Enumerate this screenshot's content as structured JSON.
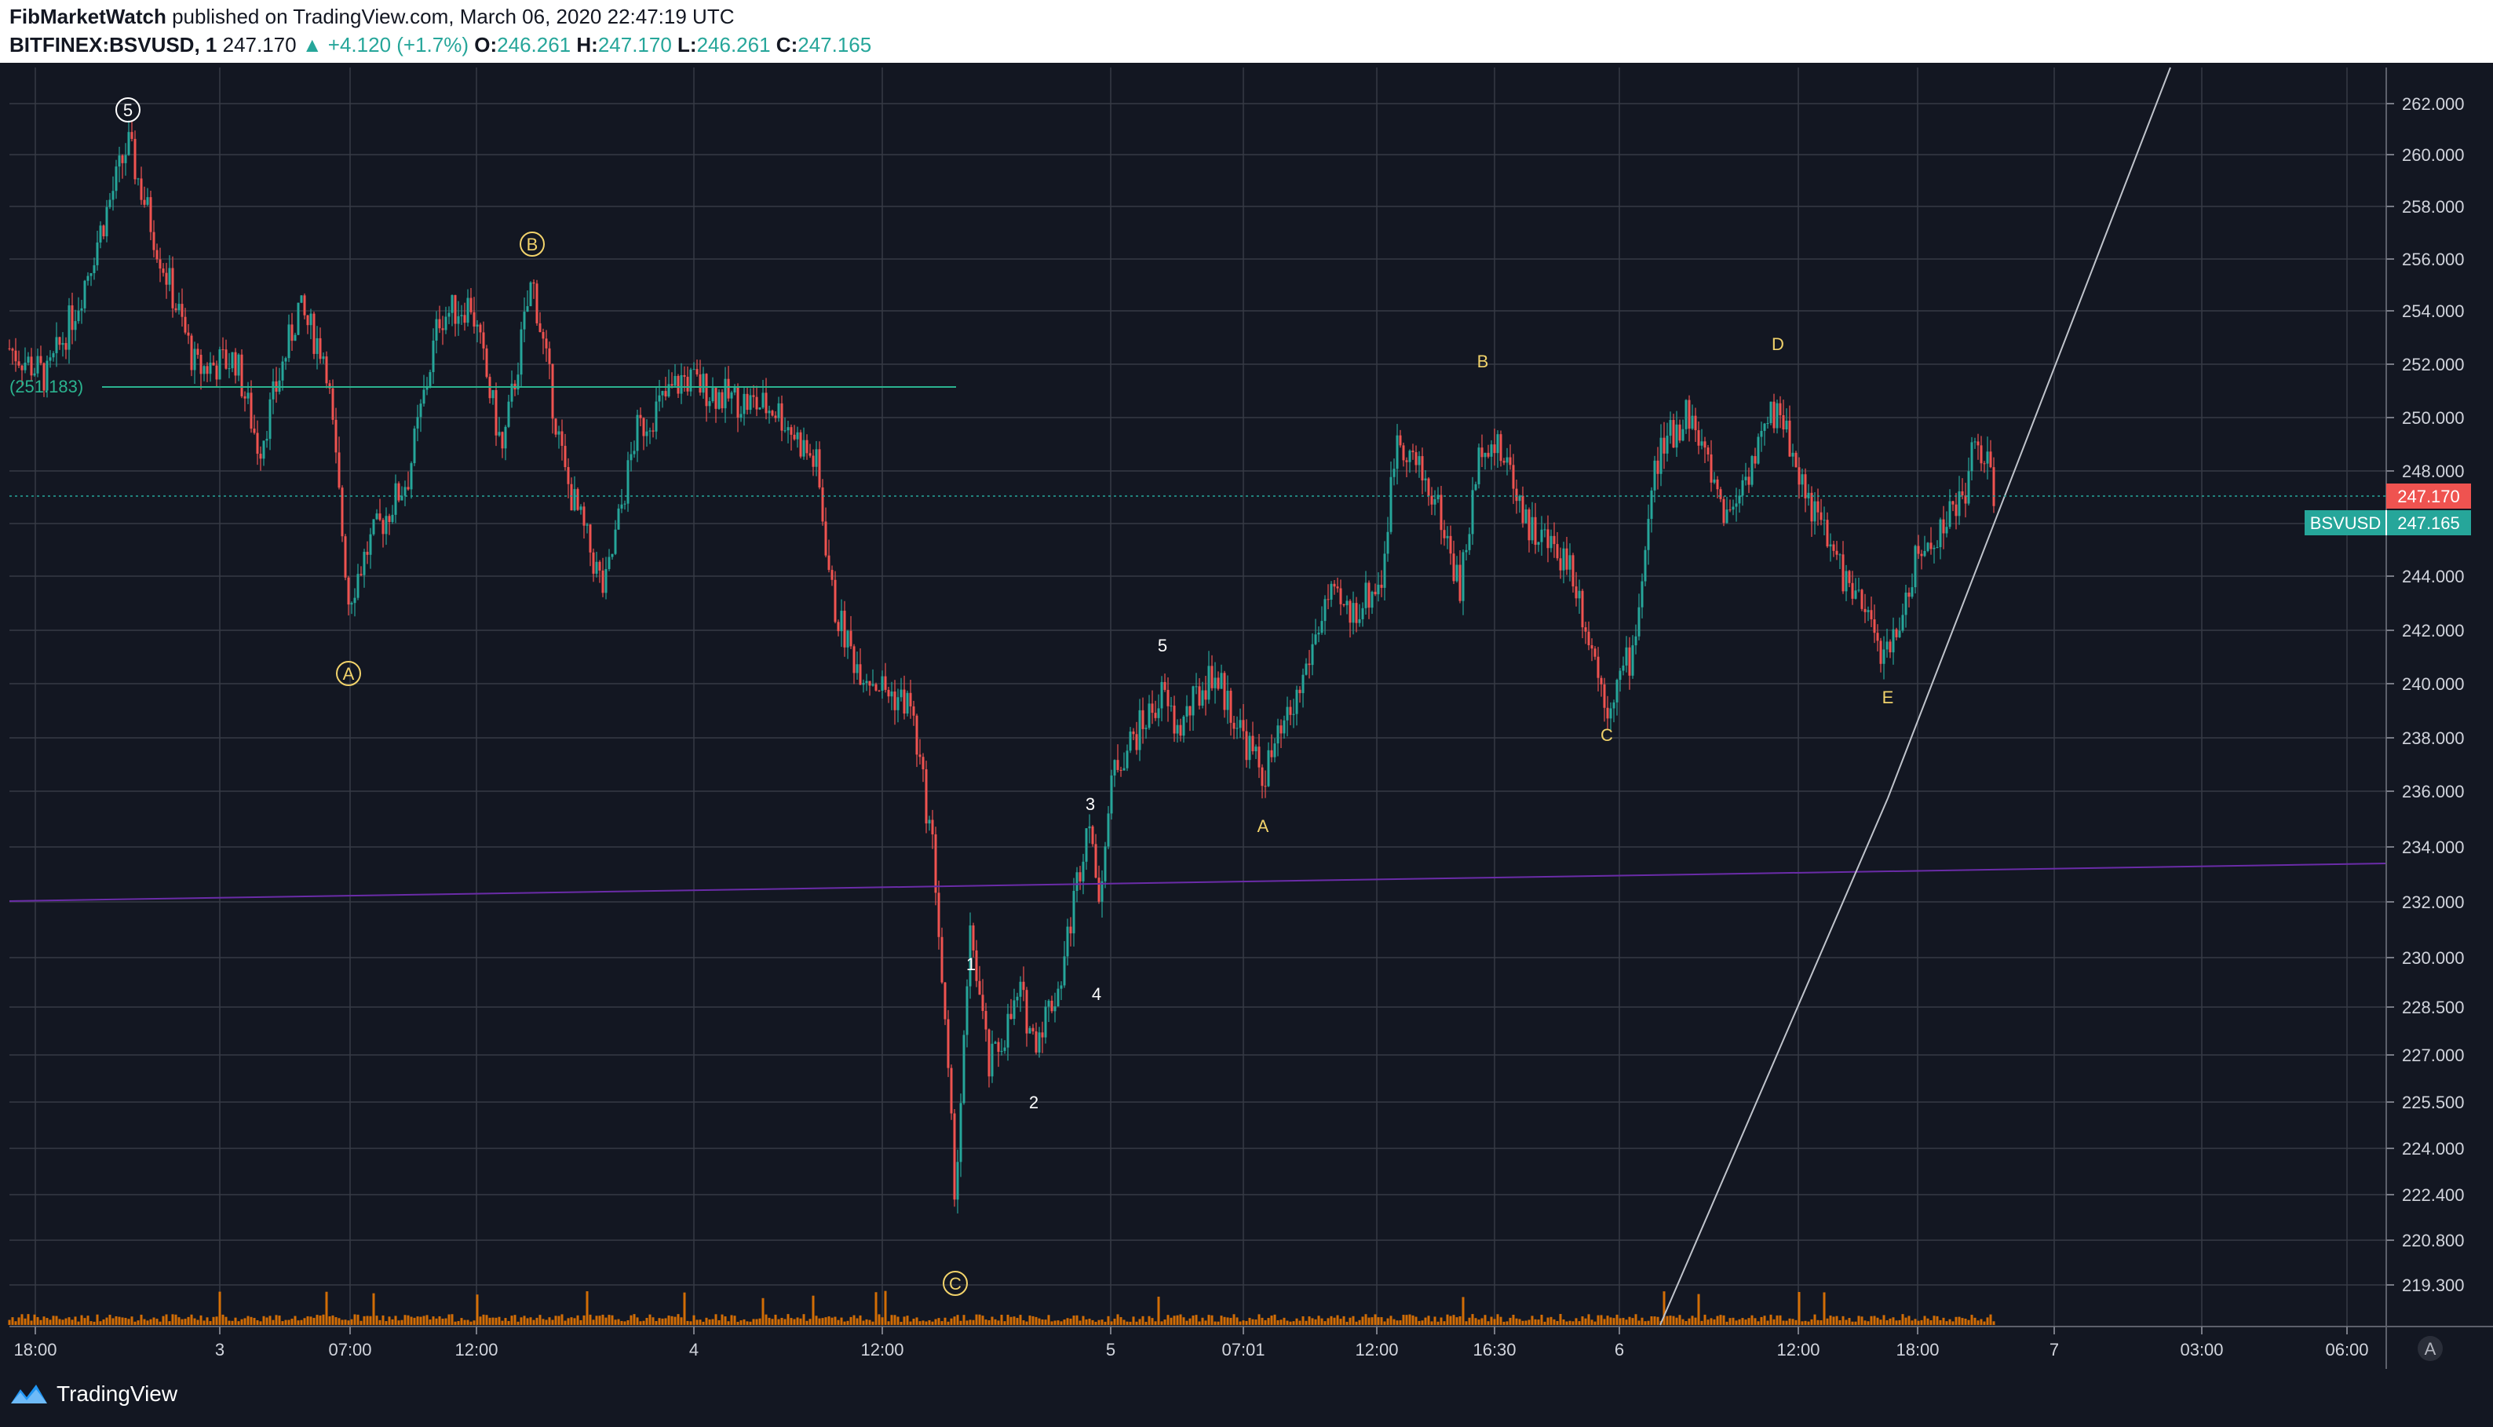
{
  "header": {
    "author": "FibMarketWatch",
    "published_text": "published on TradingView.com, March 06, 2020 22:47:19 UTC",
    "symbol": "BITFINEX:BSVUSD, 1",
    "last": "247.170",
    "change": "▲ +4.120 (+1.7%)",
    "open_label": "O:",
    "open": "246.261",
    "high_label": "H:",
    "high": "247.170",
    "low_label": "L:",
    "low": "246.261",
    "close_label": "C:",
    "close": "247.165"
  },
  "colors": {
    "background": "#131722",
    "grid": "#363a45",
    "up": "#26a69a",
    "down": "#ef5350",
    "volume": "#f57c00",
    "wave_label": "#f2d36b",
    "trendline": "#c0c4cc",
    "purple_line": "#6a2ca8",
    "fib_line": "#2bb38f"
  },
  "price_axis": {
    "ticks": [
      "262.000",
      "260.000",
      "258.000",
      "256.000",
      "254.000",
      "252.000",
      "250.000",
      "248.000",
      "246.000",
      "244.000",
      "242.000",
      "240.000",
      "238.000",
      "236.000",
      "234.000",
      "232.000",
      "230.000",
      "228.500",
      "227.000",
      "225.500",
      "224.000",
      "222.400",
      "220.800",
      "219.300"
    ],
    "last_price_tag": "247.170",
    "symbol_tag_name": "BSVUSD",
    "symbol_tag_price": "247.165",
    "auto_button": "A"
  },
  "time_axis": {
    "labels": [
      "18:00",
      "3",
      "07:00",
      "12:00",
      "4",
      "12:00",
      "5",
      "07:01",
      "12:00",
      "16:30",
      "6",
      "12:00",
      "18:00",
      "7",
      "03:00",
      "06:00"
    ]
  },
  "annotations": {
    "fib_label": "(251.183)",
    "wave_circled": [
      "5",
      "A",
      "B",
      "C"
    ],
    "wave_small_white": [
      "1",
      "2",
      "3",
      "4",
      "5"
    ],
    "wave_small_yellow": [
      "A",
      "B",
      "C",
      "D",
      "E"
    ]
  },
  "footer": {
    "logo_text": "TradingView"
  }
}
